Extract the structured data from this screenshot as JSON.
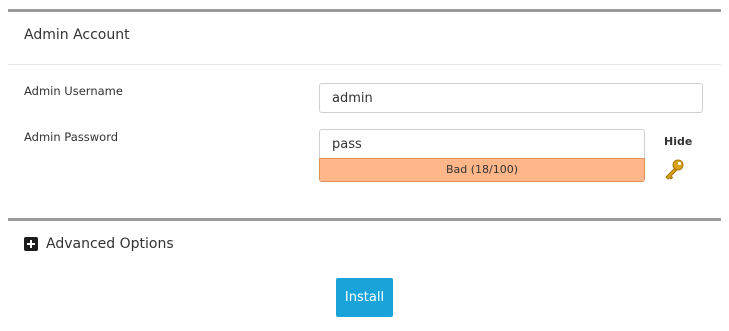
{
  "section": {
    "title": "Admin Account"
  },
  "fields": {
    "username": {
      "label": "Admin Username",
      "value": "admin"
    },
    "password": {
      "label": "Admin Password",
      "value": "pass",
      "strength_text": "Bad (18/100)",
      "strength_score": 18,
      "strength_color": "#ffb78a",
      "hide_label": "Hide"
    }
  },
  "advanced": {
    "label": "Advanced Options"
  },
  "actions": {
    "install_label": "Install",
    "install_color": "#1aa3d8"
  },
  "icons": {
    "toggle": "plus-square-icon",
    "password_generator": "key-icon"
  }
}
